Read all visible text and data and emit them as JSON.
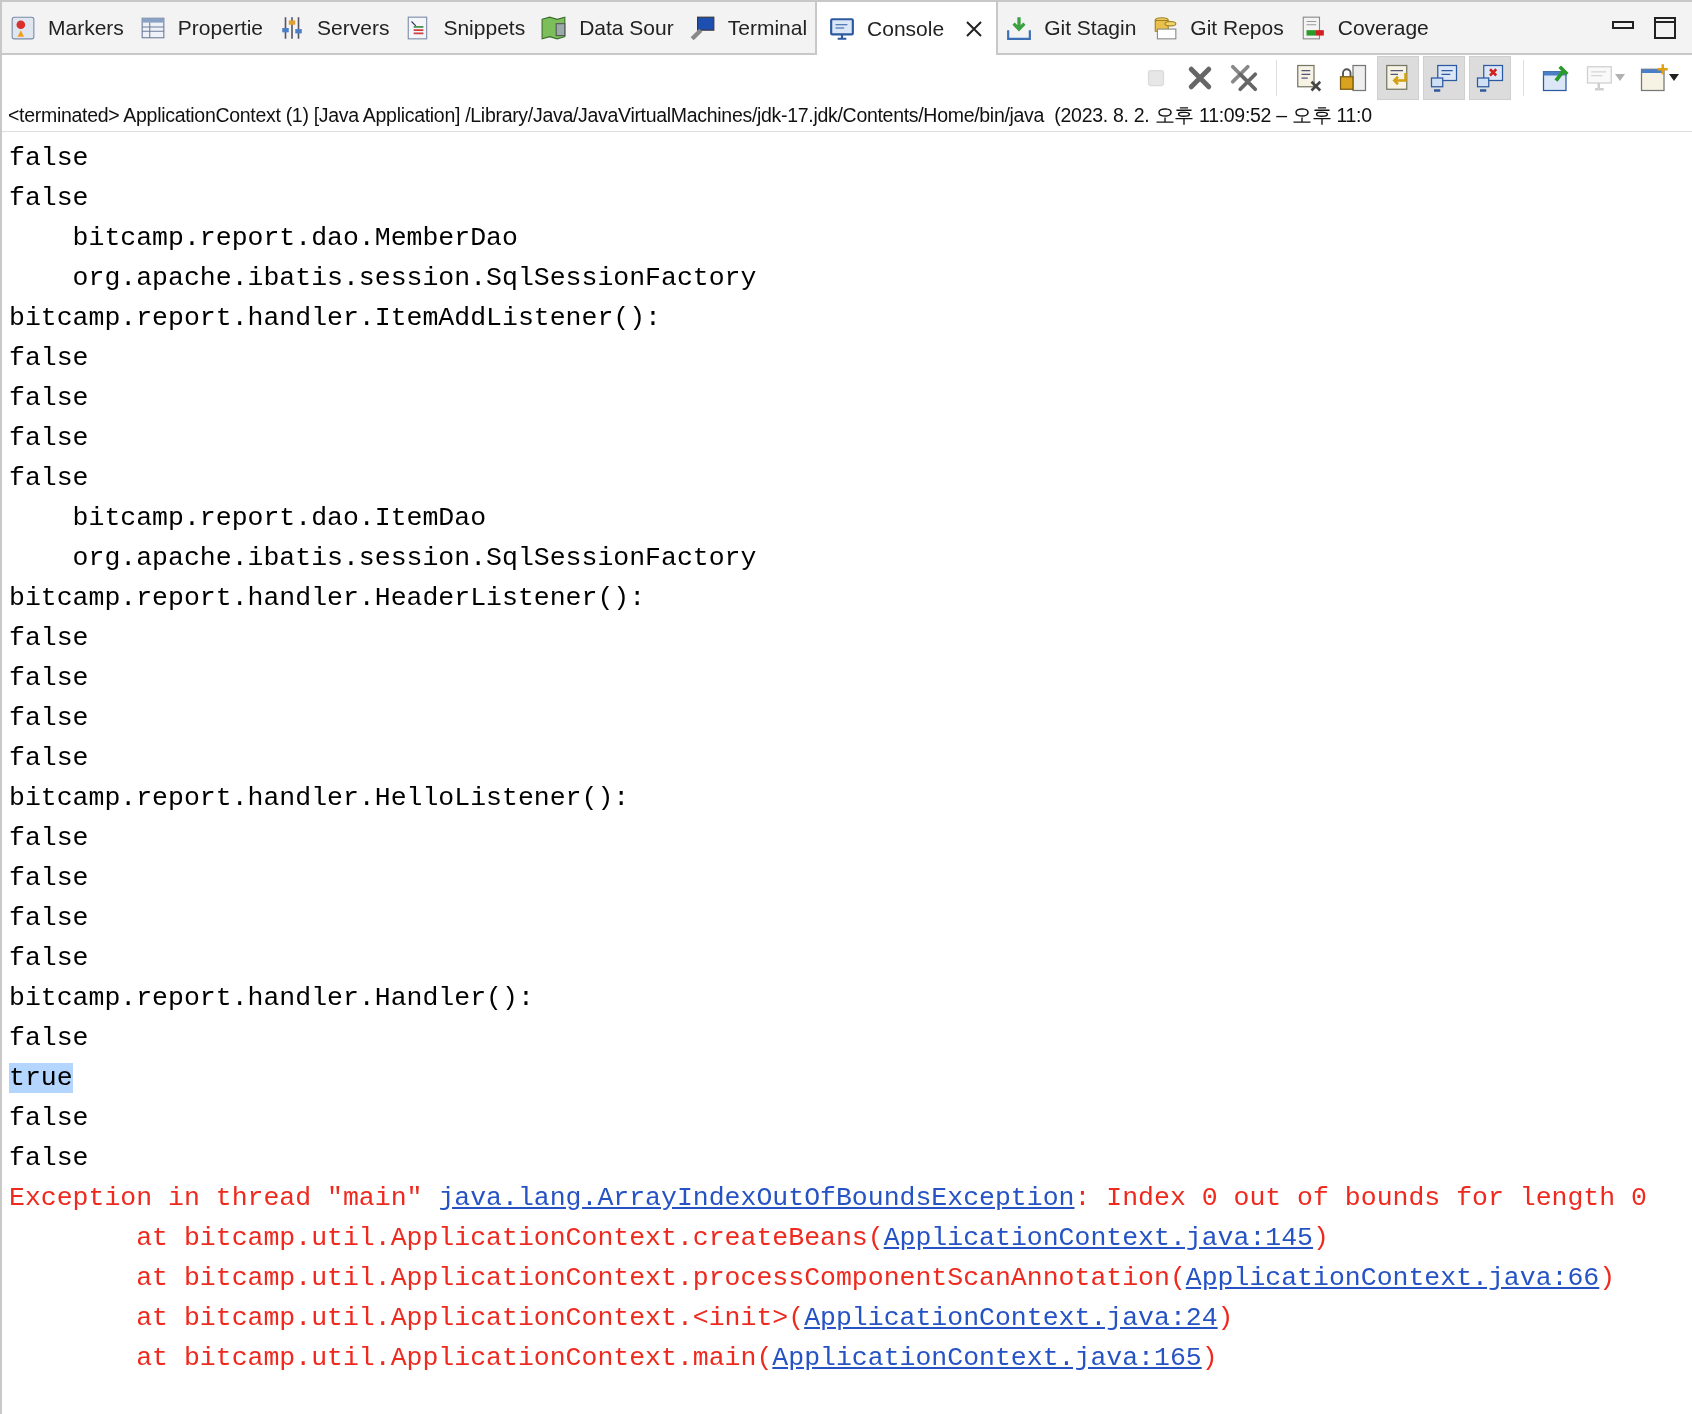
{
  "tabs": [
    {
      "label": "Markers",
      "selected": false
    },
    {
      "label": "Propertie",
      "selected": false
    },
    {
      "label": "Servers",
      "selected": false
    },
    {
      "label": "Snippets",
      "selected": false
    },
    {
      "label": "Data Sour",
      "selected": false
    },
    {
      "label": "Terminal",
      "selected": false
    },
    {
      "label": "Console",
      "selected": true
    },
    {
      "label": "Git Stagin",
      "selected": false
    },
    {
      "label": "Git Repos",
      "selected": false
    },
    {
      "label": "Coverage",
      "selected": false
    }
  ],
  "toolbar": [
    {
      "disabled": true,
      "pressed": false
    },
    {
      "disabled": false,
      "pressed": false
    },
    {
      "disabled": false,
      "pressed": false
    },
    {
      "disabled": false,
      "pressed": false
    },
    {
      "disabled": false,
      "pressed": false
    },
    {
      "disabled": false,
      "pressed": true
    },
    {
      "disabled": false,
      "pressed": true
    },
    {
      "disabled": false,
      "pressed": true
    },
    {
      "disabled": false,
      "pressed": false
    },
    {
      "disabled": true,
      "pressed": false
    },
    {
      "disabled": false,
      "pressed": false
    }
  ],
  "process_label": "<terminated> ApplicationContext (1) [Java Application] /Library/Java/JavaVirtualMachines/jdk-17.jdk/Contents/Home/bin/java  (2023. 8. 2. 오후 11:09:52 – 오후 11:0",
  "lines": [
    {
      "kind": "output",
      "text": "false",
      "selected": false
    },
    {
      "kind": "output",
      "text": "false",
      "selected": false
    },
    {
      "kind": "output",
      "text": "    bitcamp.report.dao.MemberDao",
      "selected": false
    },
    {
      "kind": "output",
      "text": "    org.apache.ibatis.session.SqlSessionFactory",
      "selected": false
    },
    {
      "kind": "output",
      "text": "bitcamp.report.handler.ItemAddListener():",
      "selected": false
    },
    {
      "kind": "output",
      "text": "false",
      "selected": false
    },
    {
      "kind": "output",
      "text": "false",
      "selected": false
    },
    {
      "kind": "output",
      "text": "false",
      "selected": false
    },
    {
      "kind": "output",
      "text": "false",
      "selected": false
    },
    {
      "kind": "output",
      "text": "    bitcamp.report.dao.ItemDao",
      "selected": false
    },
    {
      "kind": "output",
      "text": "    org.apache.ibatis.session.SqlSessionFactory",
      "selected": false
    },
    {
      "kind": "output",
      "text": "bitcamp.report.handler.HeaderListener():",
      "selected": false
    },
    {
      "kind": "output",
      "text": "false",
      "selected": false
    },
    {
      "kind": "output",
      "text": "false",
      "selected": false
    },
    {
      "kind": "output",
      "text": "false",
      "selected": false
    },
    {
      "kind": "output",
      "text": "false",
      "selected": false
    },
    {
      "kind": "output",
      "text": "bitcamp.report.handler.HelloListener():",
      "selected": false
    },
    {
      "kind": "output",
      "text": "false",
      "selected": false
    },
    {
      "kind": "output",
      "text": "false",
      "selected": false
    },
    {
      "kind": "output",
      "text": "false",
      "selected": false
    },
    {
      "kind": "output",
      "text": "false",
      "selected": false
    },
    {
      "kind": "output",
      "text": "bitcamp.report.handler.Handler():",
      "selected": false
    },
    {
      "kind": "output",
      "text": "false",
      "selected": false
    },
    {
      "kind": "output",
      "text": "true",
      "selected": true
    },
    {
      "kind": "output",
      "text": "false",
      "selected": false
    },
    {
      "kind": "output",
      "text": "false",
      "selected": false
    },
    {
      "kind": "error",
      "selected": false,
      "parts": [
        {
          "kind": "text",
          "text": "Exception in thread \"main\" "
        },
        {
          "kind": "link",
          "text": "java.lang.ArrayIndexOutOfBoundsException"
        },
        {
          "kind": "text",
          "text": ": Index 0 out of bounds for length 0"
        }
      ]
    },
    {
      "kind": "error",
      "selected": false,
      "parts": [
        {
          "kind": "text",
          "text": "        at bitcamp.util.ApplicationContext.createBeans("
        },
        {
          "kind": "link",
          "text": "ApplicationContext.java:145"
        },
        {
          "kind": "text",
          "text": ")"
        }
      ]
    },
    {
      "kind": "error",
      "selected": false,
      "parts": [
        {
          "kind": "text",
          "text": "        at bitcamp.util.ApplicationContext.processComponentScanAnnotation("
        },
        {
          "kind": "link",
          "text": "ApplicationContext.java:66"
        },
        {
          "kind": "text",
          "text": ")"
        }
      ]
    },
    {
      "kind": "error",
      "selected": false,
      "parts": [
        {
          "kind": "text",
          "text": "        at bitcamp.util.ApplicationContext.<init>("
        },
        {
          "kind": "link",
          "text": "ApplicationContext.java:24"
        },
        {
          "kind": "text",
          "text": ")"
        }
      ]
    },
    {
      "kind": "error",
      "selected": false,
      "parts": [
        {
          "kind": "text",
          "text": "        at bitcamp.util.ApplicationContext.main("
        },
        {
          "kind": "link",
          "text": "ApplicationContext.java:165"
        },
        {
          "kind": "text",
          "text": ")"
        }
      ]
    }
  ]
}
